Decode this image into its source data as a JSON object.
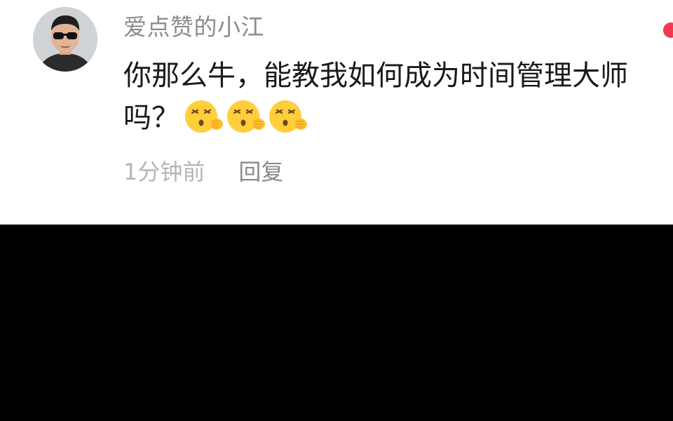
{
  "comment": {
    "username": "爱点赞的小江",
    "text": "你那么牛，能教我如何成为时间管理大师吗？",
    "emojis": [
      "sleepy-face-emoji",
      "sleepy-face-emoji",
      "sleepy-face-emoji"
    ],
    "timestamp": "1分钟前",
    "reply_label": "回复"
  },
  "colors": {
    "username": "#8c8c8c",
    "timestamp": "#b5b5b5",
    "reply": "#8a8a8a",
    "notification_dot": "#f23a50",
    "background_bottom": "#000000"
  }
}
